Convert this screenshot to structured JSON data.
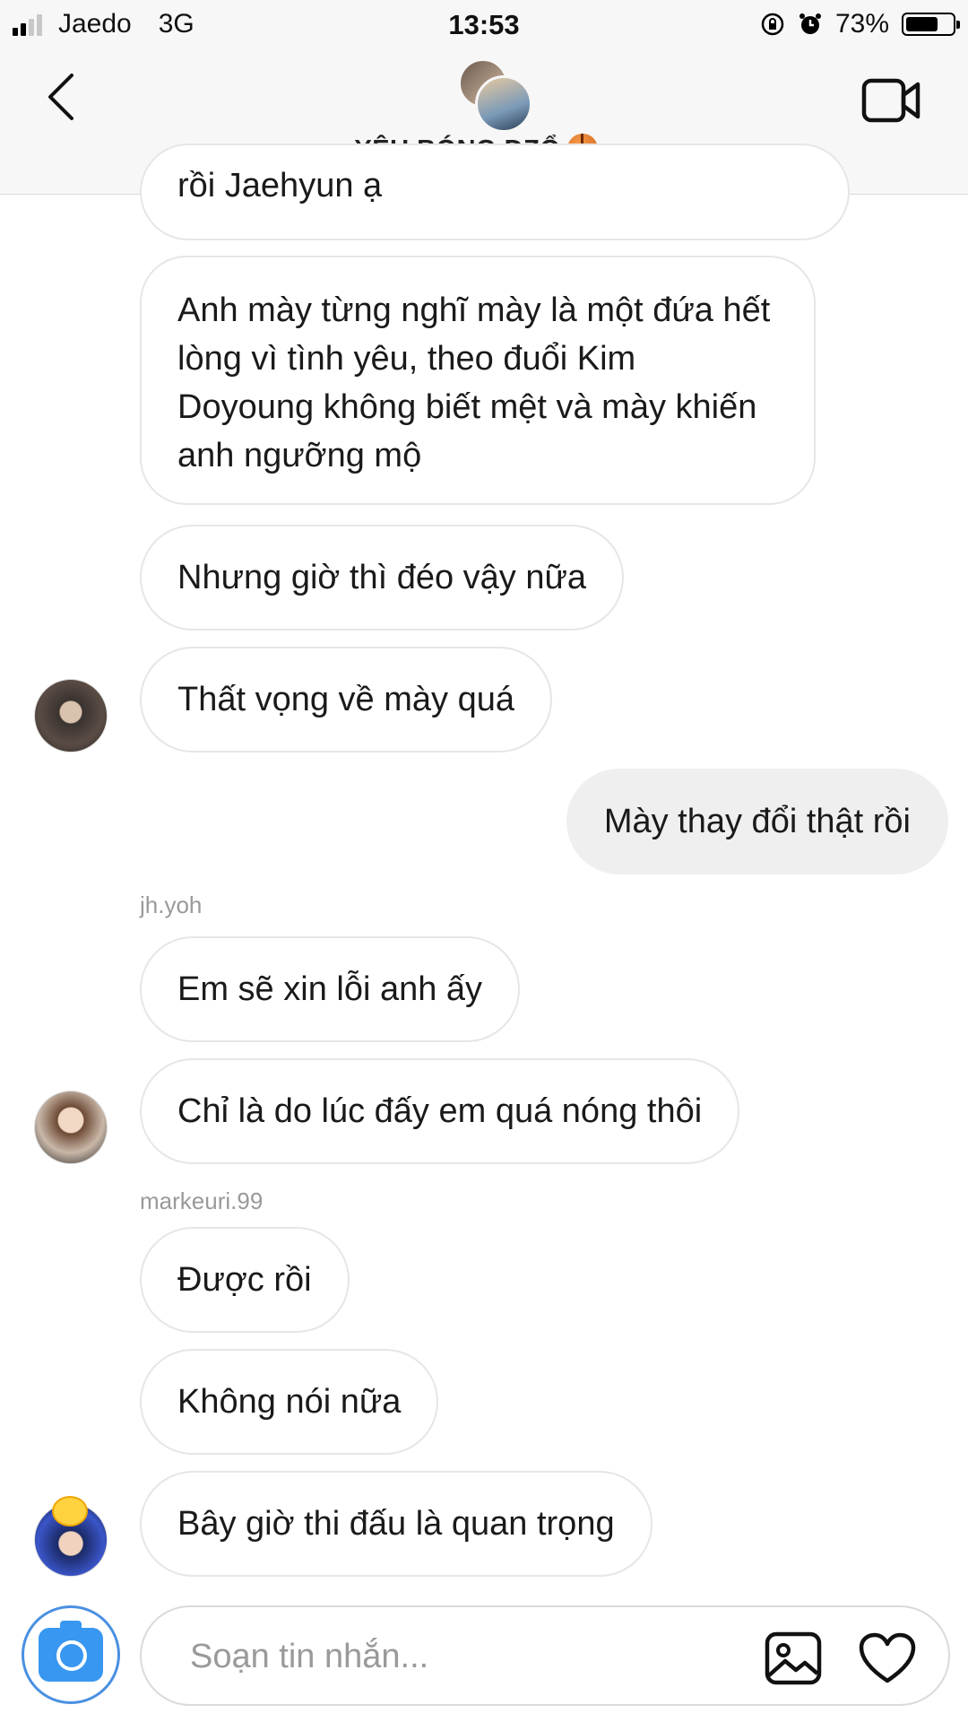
{
  "status_bar": {
    "carrier": "Jaedo",
    "network": "3G",
    "time": "13:53",
    "battery_percent": "73%",
    "battery_level": 0.73,
    "signal_bars": 2
  },
  "header": {
    "title": "YÊU BÓNG DZỔ",
    "title_emoji": "basketball-icon",
    "back_icon": "chevron-left-icon",
    "video_icon": "video-camera-icon"
  },
  "messages": [
    {
      "sender": "",
      "text": "rồi Jaehyun ạ",
      "direction": "incoming"
    },
    {
      "sender": "",
      "text": "Anh mày từng nghĩ mày là một đứa hết lòng vì tình yêu, theo đuổi Kim Doyoung không biết mệt và mày khiến anh ngưỡng mộ",
      "direction": "incoming"
    },
    {
      "sender": "",
      "text": "Nhưng giờ thì đéo vậy nữa",
      "direction": "incoming"
    },
    {
      "sender": "",
      "text": "Thất vọng về mày quá",
      "direction": "incoming"
    },
    {
      "sender": "",
      "text": "Mày thay đổi thật rồi",
      "direction": "outgoing"
    },
    {
      "sender": "jh.yoh",
      "text": "Em sẽ xin lỗi anh ấy",
      "direction": "incoming"
    },
    {
      "sender": "",
      "text": "Chỉ là do lúc đấy em quá nóng thôi",
      "direction": "incoming"
    },
    {
      "sender": "markeuri.99",
      "text": "Được rồi",
      "direction": "incoming"
    },
    {
      "sender": "",
      "text": "Không nói nữa",
      "direction": "incoming"
    },
    {
      "sender": "",
      "text": "Bây giờ thi đấu là quan trọng",
      "direction": "incoming"
    }
  ],
  "composer": {
    "placeholder": "Soạn tin nhắn...",
    "camera_icon": "camera-icon",
    "gallery_icon": "image-gallery-icon",
    "like_icon": "heart-icon",
    "accent_color": "#3897f0"
  }
}
